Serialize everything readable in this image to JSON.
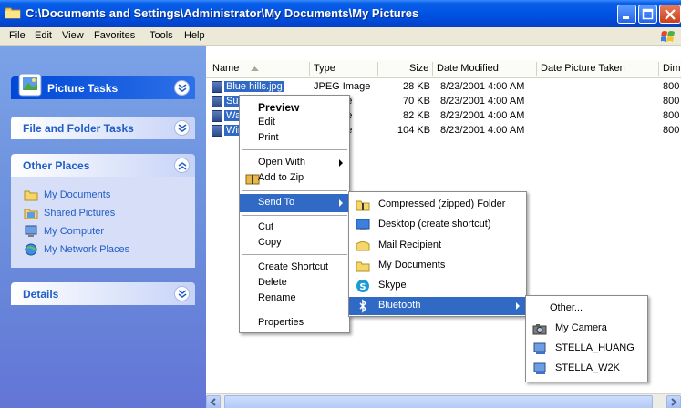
{
  "window": {
    "title": "C:\\Documents and Settings\\Administrator\\My Documents\\My Pictures"
  },
  "menubar": [
    "File",
    "Edit",
    "View",
    "Favorites",
    "Tools",
    "Help"
  ],
  "taskpane": {
    "picture_tasks": "Picture Tasks",
    "file_folder_tasks": "File and Folder Tasks",
    "other_places": {
      "title": "Other Places",
      "items": [
        "My Documents",
        "Shared Pictures",
        "My Computer",
        "My Network Places"
      ]
    },
    "details": "Details"
  },
  "columns": [
    "Name",
    "Type",
    "Size",
    "Date Modified",
    "Date Picture Taken",
    "Dim"
  ],
  "files": [
    {
      "name": "Blue hills.jpg",
      "type": "JPEG Image",
      "size": "28 KB",
      "modified": "8/23/2001 4:00 AM",
      "dim": "800"
    },
    {
      "name": "Sun",
      "type": "age",
      "size": "70 KB",
      "modified": "8/23/2001 4:00 AM",
      "dim": "800"
    },
    {
      "name": "Wa",
      "type": "age",
      "size": "82 KB",
      "modified": "8/23/2001 4:00 AM",
      "dim": "800"
    },
    {
      "name": "Win",
      "type": "age",
      "size": "104 KB",
      "modified": "8/23/2001 4:00 AM",
      "dim": "800"
    }
  ],
  "context_menu": {
    "preview": "Preview",
    "edit": "Edit",
    "print": "Print",
    "open_with": "Open With",
    "add_to_zip": "Add to Zip",
    "send_to": "Send To",
    "cut": "Cut",
    "copy": "Copy",
    "create_shortcut": "Create Shortcut",
    "delete": "Delete",
    "rename": "Rename",
    "properties": "Properties"
  },
  "send_to_menu": [
    "Compressed (zipped) Folder",
    "Desktop (create shortcut)",
    "Mail Recipient",
    "My Documents",
    "Skype",
    "Bluetooth"
  ],
  "bluetooth_menu": [
    "Other...",
    "My Camera",
    "STELLA_HUANG",
    "STELLA_W2K"
  ],
  "colors": {
    "title_blue": "#0055e5",
    "selection": "#316ac5",
    "taskpane_link": "#215dc6"
  }
}
